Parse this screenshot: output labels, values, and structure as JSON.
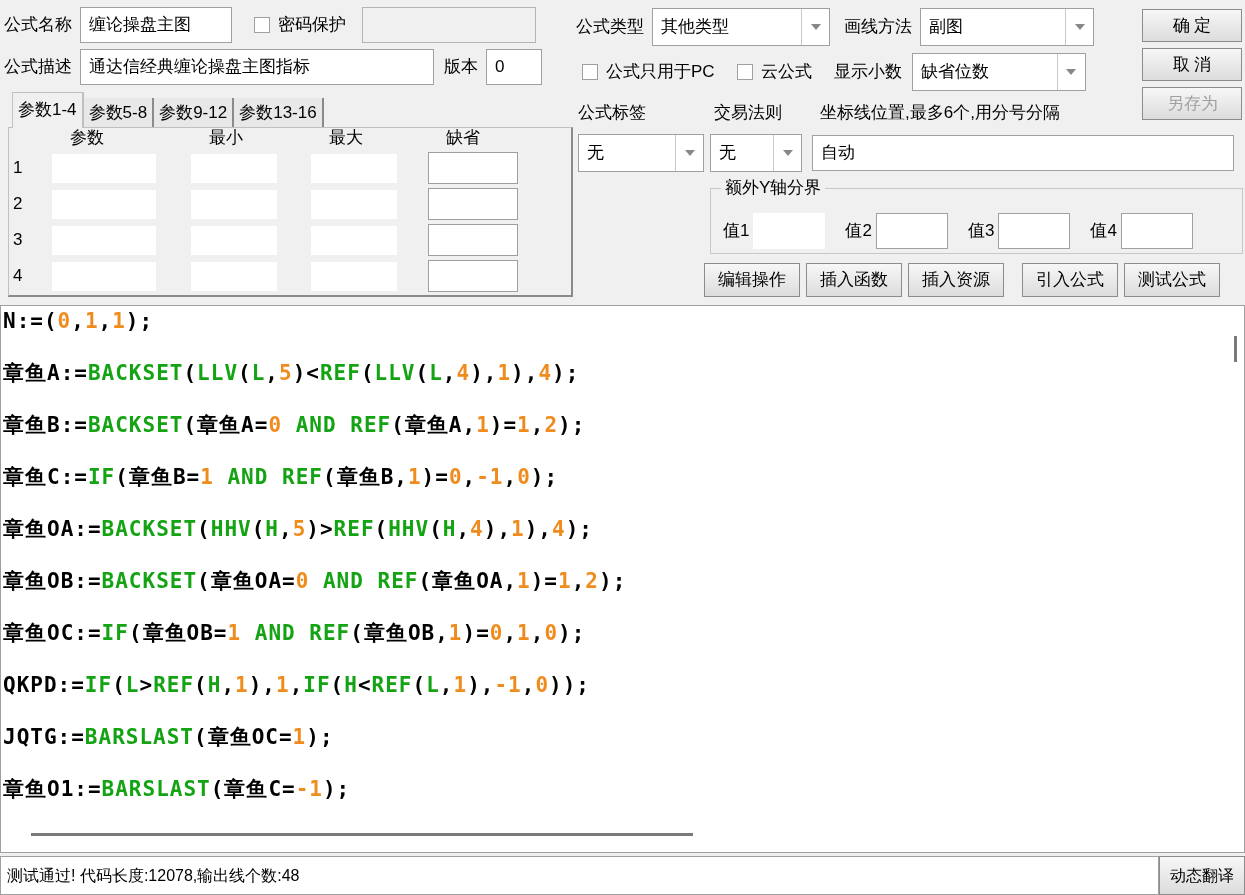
{
  "name_field": {
    "label": "公式名称",
    "value": "缠论操盘主图"
  },
  "password": {
    "label": "密码保护",
    "checked": false
  },
  "description_field": {
    "label": "公式描述",
    "value": "通达信经典缠论操盘主图指标"
  },
  "version_field": {
    "label": "版本",
    "value": "0"
  },
  "param_tabs": [
    {
      "label": "参数1-4",
      "selected": true
    },
    {
      "label": "参数5-8",
      "selected": false
    },
    {
      "label": "参数9-12",
      "selected": false
    },
    {
      "label": "参数13-16",
      "selected": false
    }
  ],
  "param_columns": [
    "参数",
    "最小",
    "最大",
    "缺省"
  ],
  "param_rows": [
    {
      "index": "1"
    },
    {
      "index": "2"
    },
    {
      "index": "3"
    },
    {
      "index": "4"
    }
  ],
  "formula_type": {
    "label": "公式类型",
    "value": "其他类型"
  },
  "draw_method": {
    "label": "画线方法",
    "value": "副图"
  },
  "pc_only": {
    "label": "公式只用于PC",
    "checked": false
  },
  "cloud": {
    "label": "云公式",
    "checked": false
  },
  "decimals": {
    "label": "显示小数",
    "value": "缺省位数"
  },
  "dialog_buttons": [
    {
      "label": "确 定",
      "disabled": false
    },
    {
      "label": "取 消",
      "disabled": false
    },
    {
      "label": "另存为",
      "disabled": true
    }
  ],
  "formula_tag": {
    "label": "公式标签",
    "value": "无"
  },
  "trade_rule": {
    "label": "交易法则",
    "value": "无"
  },
  "axis_lines": {
    "label": "坐标线位置,最多6个,用分号分隔",
    "value": "自动"
  },
  "y_axis_group": {
    "title": "额外Y轴分界",
    "fields": [
      {
        "label": "值1"
      },
      {
        "label": "值2"
      },
      {
        "label": "值3"
      },
      {
        "label": "值4"
      }
    ]
  },
  "tool_buttons": [
    "编辑操作",
    "插入函数",
    "插入资源",
    "引入公式",
    "测试公式"
  ],
  "code_lines": [
    [
      {
        "kind": "plain",
        "text": "N:=("
      },
      {
        "kind": "num",
        "text": "0"
      },
      {
        "kind": "plain",
        "text": ","
      },
      {
        "kind": "num",
        "text": "1"
      },
      {
        "kind": "plain",
        "text": ","
      },
      {
        "kind": "num",
        "text": "1"
      },
      {
        "kind": "plain",
        "text": ");"
      }
    ],
    [
      {
        "kind": "plain",
        "text": "章鱼A:="
      },
      {
        "kind": "func",
        "text": "BACKSET"
      },
      {
        "kind": "plain",
        "text": "("
      },
      {
        "kind": "func",
        "text": "LLV"
      },
      {
        "kind": "plain",
        "text": "("
      },
      {
        "kind": "func",
        "text": "L"
      },
      {
        "kind": "plain",
        "text": ","
      },
      {
        "kind": "num",
        "text": "5"
      },
      {
        "kind": "plain",
        "text": ")<"
      },
      {
        "kind": "func",
        "text": "REF"
      },
      {
        "kind": "plain",
        "text": "("
      },
      {
        "kind": "func",
        "text": "LLV"
      },
      {
        "kind": "plain",
        "text": "("
      },
      {
        "kind": "func",
        "text": "L"
      },
      {
        "kind": "plain",
        "text": ","
      },
      {
        "kind": "num",
        "text": "4"
      },
      {
        "kind": "plain",
        "text": "),"
      },
      {
        "kind": "num",
        "text": "1"
      },
      {
        "kind": "plain",
        "text": "),"
      },
      {
        "kind": "num",
        "text": "4"
      },
      {
        "kind": "plain",
        "text": ");"
      }
    ],
    [
      {
        "kind": "plain",
        "text": "章鱼B:="
      },
      {
        "kind": "func",
        "text": "BACKSET"
      },
      {
        "kind": "plain",
        "text": "(章鱼A="
      },
      {
        "kind": "num",
        "text": "0"
      },
      {
        "kind": "func",
        "text": " AND"
      },
      {
        "kind": "func",
        "text": " REF"
      },
      {
        "kind": "plain",
        "text": "(章鱼A,"
      },
      {
        "kind": "num",
        "text": "1"
      },
      {
        "kind": "plain",
        "text": ")="
      },
      {
        "kind": "num",
        "text": "1"
      },
      {
        "kind": "plain",
        "text": ","
      },
      {
        "kind": "num",
        "text": "2"
      },
      {
        "kind": "plain",
        "text": ");"
      }
    ],
    [
      {
        "kind": "plain",
        "text": "章鱼C:="
      },
      {
        "kind": "func",
        "text": "IF"
      },
      {
        "kind": "plain",
        "text": "(章鱼B="
      },
      {
        "kind": "num",
        "text": "1"
      },
      {
        "kind": "func",
        "text": " AND"
      },
      {
        "kind": "func",
        "text": " REF"
      },
      {
        "kind": "plain",
        "text": "(章鱼B,"
      },
      {
        "kind": "num",
        "text": "1"
      },
      {
        "kind": "plain",
        "text": ")="
      },
      {
        "kind": "num",
        "text": "0"
      },
      {
        "kind": "plain",
        "text": ","
      },
      {
        "kind": "num",
        "text": "-1"
      },
      {
        "kind": "plain",
        "text": ","
      },
      {
        "kind": "num",
        "text": "0"
      },
      {
        "kind": "plain",
        "text": ");"
      }
    ],
    [
      {
        "kind": "plain",
        "text": "章鱼OA:="
      },
      {
        "kind": "func",
        "text": "BACKSET"
      },
      {
        "kind": "plain",
        "text": "("
      },
      {
        "kind": "func",
        "text": "HHV"
      },
      {
        "kind": "plain",
        "text": "("
      },
      {
        "kind": "func",
        "text": "H"
      },
      {
        "kind": "plain",
        "text": ","
      },
      {
        "kind": "num",
        "text": "5"
      },
      {
        "kind": "plain",
        "text": ")>"
      },
      {
        "kind": "func",
        "text": "REF"
      },
      {
        "kind": "plain",
        "text": "("
      },
      {
        "kind": "func",
        "text": "HHV"
      },
      {
        "kind": "plain",
        "text": "("
      },
      {
        "kind": "func",
        "text": "H"
      },
      {
        "kind": "plain",
        "text": ","
      },
      {
        "kind": "num",
        "text": "4"
      },
      {
        "kind": "plain",
        "text": "),"
      },
      {
        "kind": "num",
        "text": "1"
      },
      {
        "kind": "plain",
        "text": "),"
      },
      {
        "kind": "num",
        "text": "4"
      },
      {
        "kind": "plain",
        "text": ");"
      }
    ],
    [
      {
        "kind": "plain",
        "text": "章鱼OB:="
      },
      {
        "kind": "func",
        "text": "BACKSET"
      },
      {
        "kind": "plain",
        "text": "(章鱼OA="
      },
      {
        "kind": "num",
        "text": "0"
      },
      {
        "kind": "func",
        "text": " AND"
      },
      {
        "kind": "func",
        "text": " REF"
      },
      {
        "kind": "plain",
        "text": "(章鱼OA,"
      },
      {
        "kind": "num",
        "text": "1"
      },
      {
        "kind": "plain",
        "text": ")="
      },
      {
        "kind": "num",
        "text": "1"
      },
      {
        "kind": "plain",
        "text": ","
      },
      {
        "kind": "num",
        "text": "2"
      },
      {
        "kind": "plain",
        "text": ");"
      }
    ],
    [
      {
        "kind": "plain",
        "text": "章鱼OC:="
      },
      {
        "kind": "func",
        "text": "IF"
      },
      {
        "kind": "plain",
        "text": "(章鱼OB="
      },
      {
        "kind": "num",
        "text": "1"
      },
      {
        "kind": "func",
        "text": " AND"
      },
      {
        "kind": "func",
        "text": " REF"
      },
      {
        "kind": "plain",
        "text": "(章鱼OB,"
      },
      {
        "kind": "num",
        "text": "1"
      },
      {
        "kind": "plain",
        "text": ")="
      },
      {
        "kind": "num",
        "text": "0"
      },
      {
        "kind": "plain",
        "text": ","
      },
      {
        "kind": "num",
        "text": "1"
      },
      {
        "kind": "plain",
        "text": ","
      },
      {
        "kind": "num",
        "text": "0"
      },
      {
        "kind": "plain",
        "text": ");"
      }
    ],
    [
      {
        "kind": "plain",
        "text": "QKPD:="
      },
      {
        "kind": "func",
        "text": "IF"
      },
      {
        "kind": "plain",
        "text": "("
      },
      {
        "kind": "func",
        "text": "L"
      },
      {
        "kind": "plain",
        "text": ">"
      },
      {
        "kind": "func",
        "text": "REF"
      },
      {
        "kind": "plain",
        "text": "("
      },
      {
        "kind": "func",
        "text": "H"
      },
      {
        "kind": "plain",
        "text": ","
      },
      {
        "kind": "num",
        "text": "1"
      },
      {
        "kind": "plain",
        "text": "),"
      },
      {
        "kind": "num",
        "text": "1"
      },
      {
        "kind": "plain",
        "text": ","
      },
      {
        "kind": "func",
        "text": "IF"
      },
      {
        "kind": "plain",
        "text": "("
      },
      {
        "kind": "func",
        "text": "H"
      },
      {
        "kind": "plain",
        "text": "<"
      },
      {
        "kind": "func",
        "text": "REF"
      },
      {
        "kind": "plain",
        "text": "("
      },
      {
        "kind": "func",
        "text": "L"
      },
      {
        "kind": "plain",
        "text": ","
      },
      {
        "kind": "num",
        "text": "1"
      },
      {
        "kind": "plain",
        "text": "),"
      },
      {
        "kind": "num",
        "text": "-1"
      },
      {
        "kind": "plain",
        "text": ","
      },
      {
        "kind": "num",
        "text": "0"
      },
      {
        "kind": "plain",
        "text": "));"
      }
    ],
    [
      {
        "kind": "plain",
        "text": "JQTG:="
      },
      {
        "kind": "func",
        "text": "BARSLAST"
      },
      {
        "kind": "plain",
        "text": "(章鱼OC="
      },
      {
        "kind": "num",
        "text": "1"
      },
      {
        "kind": "plain",
        "text": ");"
      }
    ],
    [
      {
        "kind": "plain",
        "text": "章鱼O1:="
      },
      {
        "kind": "func",
        "text": "BARSLAST"
      },
      {
        "kind": "plain",
        "text": "(章鱼C="
      },
      {
        "kind": "num",
        "text": "-1"
      },
      {
        "kind": "plain",
        "text": ");"
      }
    ]
  ],
  "status": {
    "message": "测试通过! 代码长度:12078,输出线个数:48",
    "button": "动态翻译"
  }
}
